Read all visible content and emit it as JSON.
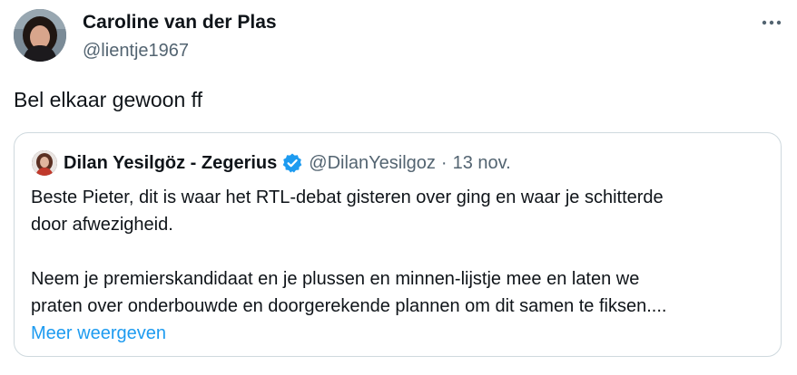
{
  "tweet": {
    "author_name": "Caroline van der Plas",
    "author_handle": "@lientje1967",
    "text": "Bel elkaar gewoon ff",
    "more_icon": "more-horizontal-icon"
  },
  "quote": {
    "author_name": "Dilan Yesilgöz - Zegerius",
    "author_handle": "@DilanYesilgoz",
    "separator": "·",
    "date": "13 nov.",
    "verified_icon": "verified-badge-icon",
    "paragraph1_line1": "Beste Pieter, dit is waar het RTL-debat gisteren over ging en waar je schitterde",
    "paragraph1_line2": "door afwezigheid.",
    "paragraph2_line1": "Neem je premierskandidaat en je plussen en minnen-lijstje mee en laten we",
    "paragraph2_line2": "praten over onderbouwde en doorgerekende plannen om dit samen te fiksen....",
    "show_more": "Meer weergeven"
  },
  "colors": {
    "text": "#0f1419",
    "secondary": "#536471",
    "link": "#1d9bf0",
    "border": "#cfd9de",
    "verified": "#1d9bf0"
  }
}
